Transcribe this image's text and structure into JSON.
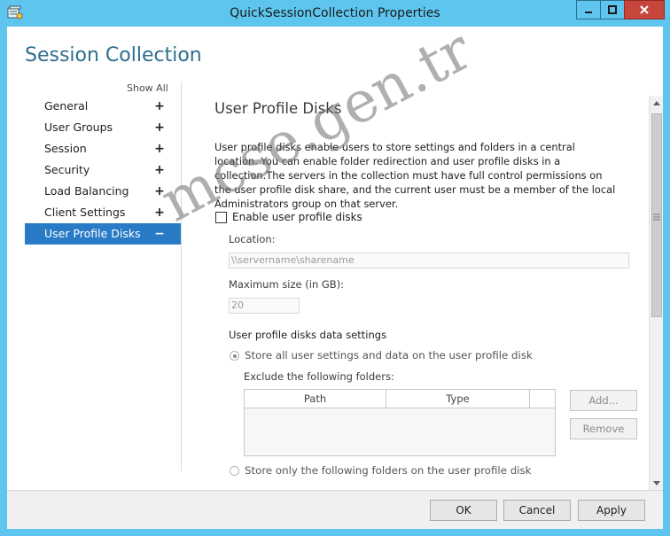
{
  "window": {
    "title": "QuickSessionCollection Properties",
    "accent_color": "#5ec6ee",
    "close_color": "#c7463c"
  },
  "header": {
    "title": "Session Collection"
  },
  "nav": {
    "show_all": "Show All",
    "items": [
      {
        "label": "General",
        "toggle": "+"
      },
      {
        "label": "User Groups",
        "toggle": "+"
      },
      {
        "label": "Session",
        "toggle": "+"
      },
      {
        "label": "Security",
        "toggle": "+"
      },
      {
        "label": "Load Balancing",
        "toggle": "+"
      },
      {
        "label": "Client Settings",
        "toggle": "+"
      },
      {
        "label": "User Profile Disks",
        "toggle": "−",
        "selected": true
      }
    ],
    "selected_color": "#2a7bc6"
  },
  "content": {
    "title": "User Profile Disks",
    "description": "User profile disks enable users to store settings and folders in a central location. You can enable folder redirection and user profile disks in a collection.The servers in the collection must have full control permissions on the user profile disk share, and the current user must be a member of the local Administrators group on that server.",
    "enable_label": "Enable user profile disks",
    "enable_checked": false,
    "location_label": "Location:",
    "location_placeholder": "\\\\servername\\sharename",
    "max_size_label": "Maximum size (in GB):",
    "max_size_value": "20",
    "data_settings_label": "User profile disks data settings",
    "radio_store_all": "Store all user settings and data on the user profile disk",
    "exclude_label": "Exclude the following folders:",
    "grid_columns": [
      "Path",
      "Type"
    ],
    "add_button": "Add...",
    "remove_button": "Remove",
    "radio_store_only": "Store only the following folders on the user profile disk"
  },
  "footer": {
    "ok": "OK",
    "cancel": "Cancel",
    "apply": "Apply"
  },
  "watermark": "mcse.gen.tr"
}
